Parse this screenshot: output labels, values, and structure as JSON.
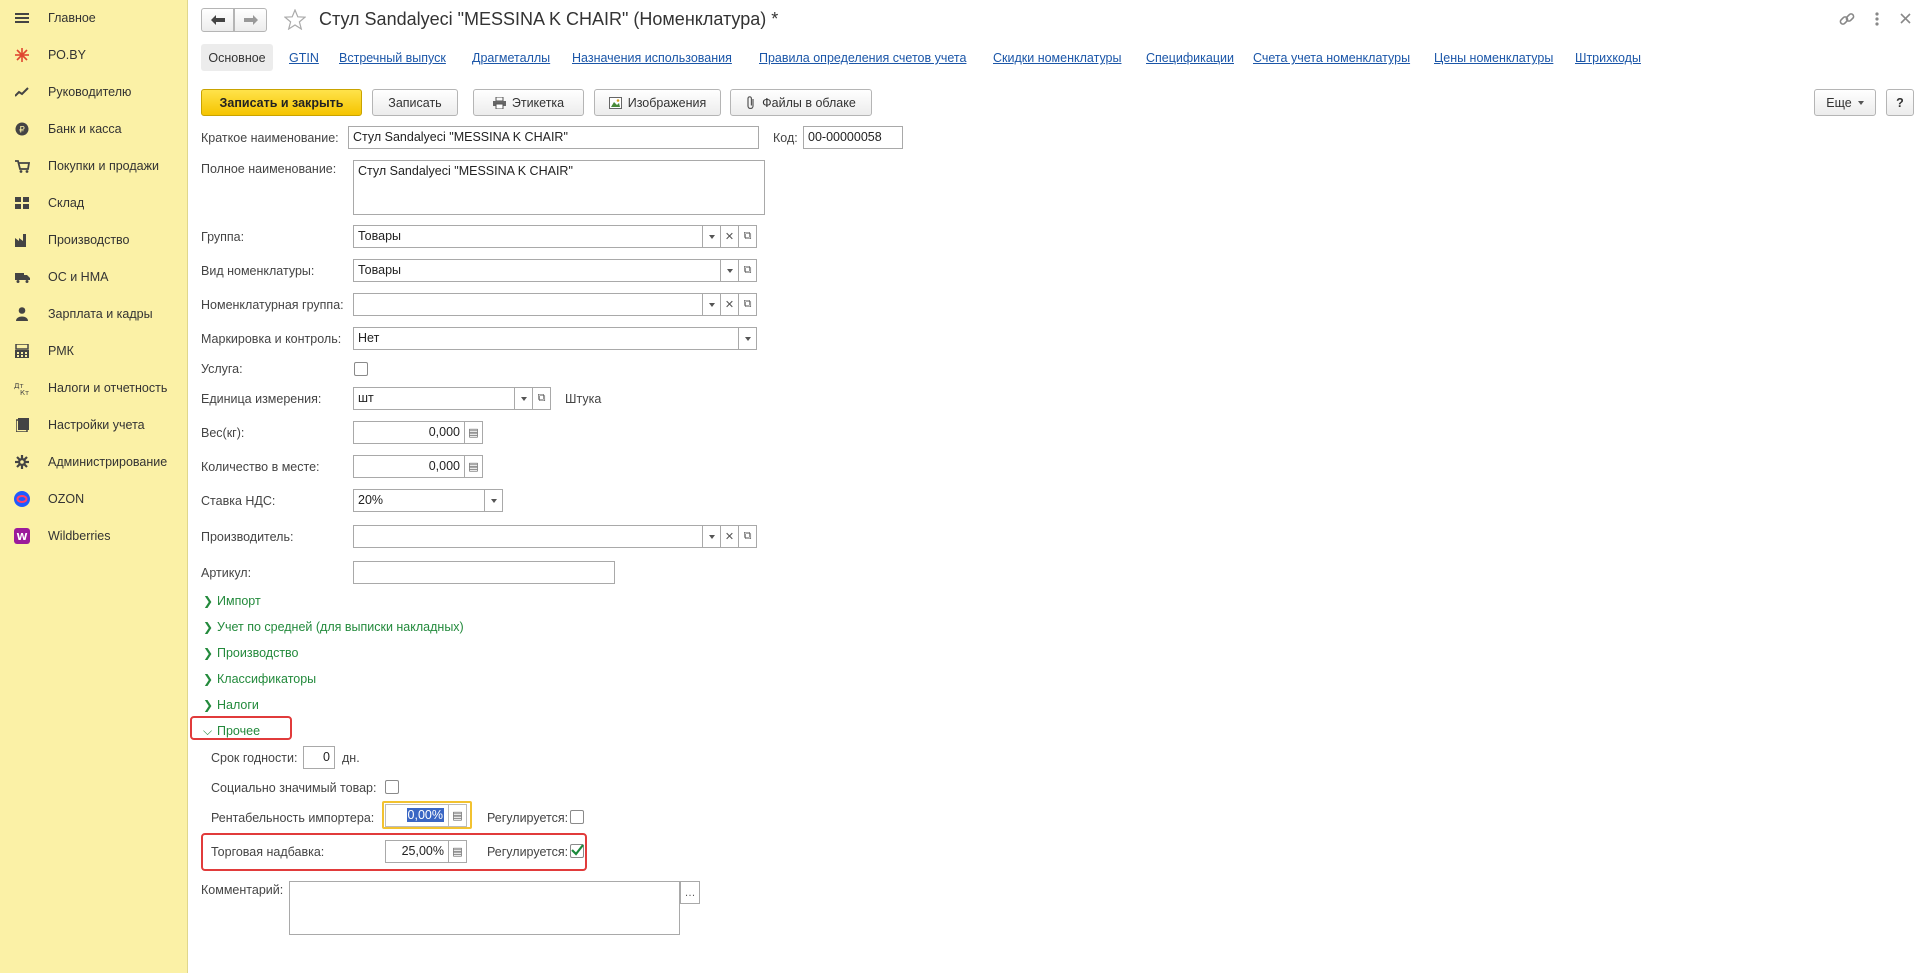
{
  "sidebar": {
    "items": [
      {
        "label": "Главное",
        "icon": "hamburger-icon"
      },
      {
        "label": "РО.BY",
        "icon": "sparkle-icon"
      },
      {
        "label": "Руководителю",
        "icon": "trend-icon"
      },
      {
        "label": "Банк и касса",
        "icon": "coin-icon"
      },
      {
        "label": "Покупки и продажи",
        "icon": "cart-icon"
      },
      {
        "label": "Склад",
        "icon": "warehouse-icon"
      },
      {
        "label": "Производство",
        "icon": "factory-icon"
      },
      {
        "label": "ОС и НМА",
        "icon": "truck-icon"
      },
      {
        "label": "Зарплата и кадры",
        "icon": "person-icon"
      },
      {
        "label": "РМК",
        "icon": "register-icon"
      },
      {
        "label": "Налоги и отчетность",
        "icon": "tax-icon"
      },
      {
        "label": "Настройки учета",
        "icon": "book-icon"
      },
      {
        "label": "Администрирование",
        "icon": "gear-icon"
      },
      {
        "label": "OZON",
        "icon": "ozon-icon"
      },
      {
        "label": "Wildberries",
        "icon": "wildberries-icon"
      }
    ]
  },
  "header": {
    "title": "Стул Sandalyeci \"MESSINA K CHAIR\" (Номенклатура) *"
  },
  "tabs": {
    "active": "Основное",
    "links": [
      "GTIN",
      "Встречный выпуск",
      "Драгметаллы",
      "Назначения использования",
      "Правила определения счетов учета",
      "Скидки номенклатуры",
      "Спецификации",
      "Счета учета номенклатуры",
      "Цены номенклатуры",
      "Штрихкоды"
    ]
  },
  "toolbar": {
    "save_close": "Записать и закрыть",
    "save": "Записать",
    "label": "Этикетка",
    "images": "Изображения",
    "cloud_files": "Файлы в облаке",
    "more": "Еще",
    "help": "?"
  },
  "form": {
    "short_name_label": "Краткое наименование:",
    "short_name": "Стул Sandalyeci \"MESSINA K CHAIR\"",
    "code_label": "Код:",
    "code": "00-00000058",
    "full_name_label": "Полное наименование:",
    "full_name": "Стул Sandalyeci \"MESSINA K CHAIR\"",
    "group_label": "Группа:",
    "group": "Товары",
    "kind_label": "Вид номенклатуры:",
    "kind": "Товары",
    "nom_group_label": "Номенклатурная группа:",
    "nom_group": "",
    "marking_label": "Маркировка и контроль:",
    "marking": "Нет",
    "service_label": "Услуга:",
    "unit_label": "Единица измерения:",
    "unit": "шт",
    "unit_name": "Штука",
    "weight_label": "Вес(кг):",
    "weight": "0,000",
    "qty_label": "Количество в месте:",
    "qty": "0,000",
    "vat_label": "Ставка НДС:",
    "vat": "20%",
    "producer_label": "Производитель:",
    "producer": "",
    "article_label": "Артикул:",
    "article": ""
  },
  "sections": [
    "Импорт",
    "Учет по средней (для выписки накладных)",
    "Производство",
    "Классификаторы",
    "Налоги",
    "Прочее"
  ],
  "other": {
    "shelf_life_label": "Срок годности:",
    "shelf_life": "0",
    "shelf_life_unit": "дн.",
    "social_label": "Социально значимый товар:",
    "importer_label": "Рентабельность импортера:",
    "importer": "0,00%",
    "regulated_label": "Регулируется:",
    "markup_label": "Торговая надбавка:",
    "markup": "25,00%",
    "regulated2_label": "Регулируется:",
    "comment_label": "Комментарий:",
    "comment": ""
  },
  "colors": {
    "sidebar_bg": "#fbf1a6",
    "primary_button": "#f5c400",
    "link": "#1b56a8",
    "section_green": "#238a3c",
    "highlight_red": "#e13b3b"
  }
}
